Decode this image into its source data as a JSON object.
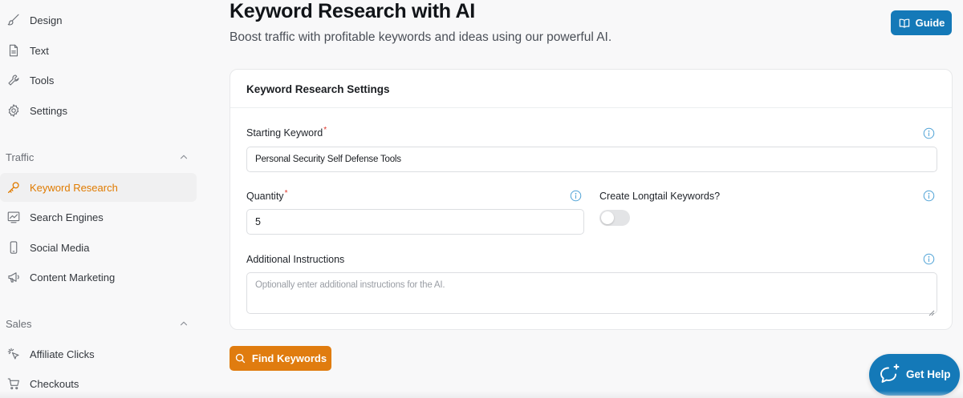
{
  "sidebar": {
    "items_top": [
      {
        "label": "Design",
        "icon": "brush-icon"
      },
      {
        "label": "Text",
        "icon": "document-icon"
      },
      {
        "label": "Tools",
        "icon": "wrench-icon"
      },
      {
        "label": "Settings",
        "icon": "gear-icon"
      }
    ],
    "traffic_section": "Traffic",
    "traffic_items": [
      {
        "label": "Keyword Research",
        "icon": "key-icon",
        "active": true
      },
      {
        "label": "Search Engines",
        "icon": "chart-icon"
      },
      {
        "label": "Social Media",
        "icon": "phone-icon"
      },
      {
        "label": "Content Marketing",
        "icon": "megaphone-icon"
      }
    ],
    "sales_section": "Sales",
    "sales_items": [
      {
        "label": "Affiliate Clicks",
        "icon": "click-icon"
      },
      {
        "label": "Checkouts",
        "icon": "cart-icon"
      }
    ]
  },
  "header": {
    "title": "Keyword Research with AI",
    "subtitle": "Boost traffic with profitable keywords and ideas using our powerful AI.",
    "guide_label": "Guide"
  },
  "card": {
    "title": "Keyword Research Settings",
    "starting_keyword_label": "Starting Keyword",
    "starting_keyword_value": "Personal Security Self Defense Tools",
    "quantity_label": "Quantity",
    "quantity_value": "5",
    "longtail_label": "Create Longtail Keywords?",
    "longtail_enabled": false,
    "instructions_label": "Additional Instructions",
    "instructions_placeholder": "Optionally enter additional instructions for the AI.",
    "required_mark": "*"
  },
  "actions": {
    "find_label": "Find Keywords",
    "help_label": "Get Help"
  },
  "colors": {
    "accent": "#e07c0f",
    "primary": "#1479b8",
    "info": "#4ea2d6"
  }
}
